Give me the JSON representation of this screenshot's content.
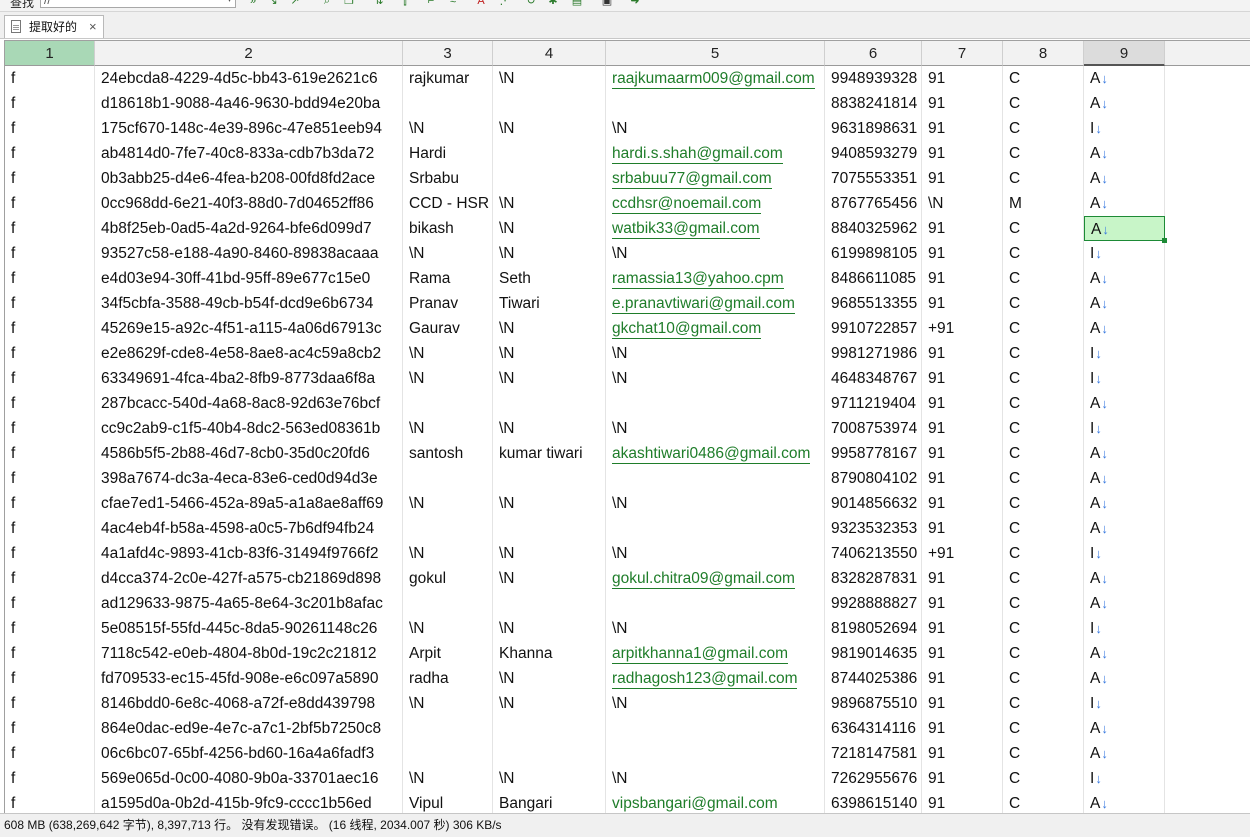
{
  "toolbar": {
    "find_label": "查找",
    "find_value": "//",
    "icons": [
      "replace-icon",
      "find-next-icon",
      "find-prev-icon",
      "search-panel-icon",
      "copy-icon",
      "sort-icon",
      "column-icon",
      "wrap-icon",
      "font-icon",
      "filter-icon",
      "refresh-icon",
      "bug-icon",
      "grid-icon",
      "view-icon",
      "run-icon"
    ]
  },
  "tab": {
    "title": "提取好的",
    "close": "×"
  },
  "columns": [
    "1",
    "2",
    "3",
    "4",
    "5",
    "6",
    "7",
    "8",
    "9"
  ],
  "rows": [
    [
      "f",
      "24ebcda8-4229-4d5c-bb43-619e2621c6",
      "rajkumar",
      "\\N",
      "raajkumaarm009@gmail.com",
      "9948939328",
      "91",
      "C",
      "A"
    ],
    [
      "f",
      "d18618b1-9088-4a46-9630-bdd94e20ba",
      "",
      "",
      "",
      "8838241814",
      "91",
      "C",
      "A"
    ],
    [
      "f",
      "175cf670-148c-4e39-896c-47e851eeb94",
      "\\N",
      "\\N",
      "\\N",
      "9631898631",
      "91",
      "C",
      "I"
    ],
    [
      "f",
      "ab4814d0-7fe7-40c8-833a-cdb7b3da72",
      "Hardi",
      "",
      "hardi.s.shah@gmail.com",
      "9408593279",
      "91",
      "C",
      "A"
    ],
    [
      "f",
      "0b3abb25-d4e6-4fea-b208-00fd8fd2ace",
      "Srbabu",
      "",
      "srbabuu77@gmail.com",
      "7075553351",
      "91",
      "C",
      "A"
    ],
    [
      "f",
      "0cc968dd-6e21-40f3-88d0-7d04652ff86",
      "CCD - HSR",
      "\\N",
      "ccdhsr@noemail.com",
      "8767765456",
      "\\N",
      "M",
      "A"
    ],
    [
      "f",
      "4b8f25eb-0ad5-4a2d-9264-bfe6d099d7",
      "bikash",
      "\\N",
      "watbik33@gmail.com",
      "8840325962",
      "91",
      "C",
      "A"
    ],
    [
      "f",
      "93527c58-e188-4a90-8460-89838acaaa",
      "\\N",
      "\\N",
      "\\N",
      "6199898105",
      "91",
      "C",
      "I"
    ],
    [
      "f",
      "e4d03e94-30ff-41bd-95ff-89e677c15e0",
      "Rama",
      "Seth",
      "ramassia13@yahoo.cpm",
      "8486611085",
      "91",
      "C",
      "A"
    ],
    [
      "f",
      "34f5cbfa-3588-49cb-b54f-dcd9e6b6734",
      "Pranav",
      "Tiwari",
      "e.pranavtiwari@gmail.com",
      "9685513355",
      "91",
      "C",
      "A"
    ],
    [
      "f",
      "45269e15-a92c-4f51-a115-4a06d67913c",
      "Gaurav",
      "\\N",
      "gkchat10@gmail.com",
      "9910722857",
      "+91",
      "C",
      "A"
    ],
    [
      "f",
      "e2e8629f-cde8-4e58-8ae8-ac4c59a8cb2",
      "\\N",
      "\\N",
      "\\N",
      "9981271986",
      "91",
      "C",
      "I"
    ],
    [
      "f",
      "63349691-4fca-4ba2-8fb9-8773daa6f8a",
      "\\N",
      "\\N",
      "\\N",
      "4648348767",
      "91",
      "C",
      "I"
    ],
    [
      "f",
      "287bcacc-540d-4a68-8ac8-92d63e76bcf",
      "",
      "",
      "",
      "9711219404",
      "91",
      "C",
      "A"
    ],
    [
      "f",
      "cc9c2ab9-c1f5-40b4-8dc2-563ed08361b",
      "\\N",
      "\\N",
      "\\N",
      "7008753974",
      "91",
      "C",
      "I"
    ],
    [
      "f",
      "4586b5f5-2b88-46d7-8cb0-35d0c20fd6",
      "santosh",
      "kumar tiwari",
      "akashtiwari0486@gmail.com",
      "9958778167",
      "91",
      "C",
      "A"
    ],
    [
      "f",
      "398a7674-dc3a-4eca-83e6-ced0d94d3e",
      "",
      "",
      "",
      "8790804102",
      "91",
      "C",
      "A"
    ],
    [
      "f",
      "cfae7ed1-5466-452a-89a5-a1a8ae8aff69",
      "\\N",
      "\\N",
      "\\N",
      "9014856632",
      "91",
      "C",
      "A"
    ],
    [
      "f",
      "4ac4eb4f-b58a-4598-a0c5-7b6df94fb24",
      "",
      "",
      "",
      "9323532353",
      "91",
      "C",
      "A"
    ],
    [
      "f",
      "4a1afd4c-9893-41cb-83f6-31494f9766f2",
      "\\N",
      "\\N",
      "\\N",
      "7406213550",
      "+91",
      "C",
      "I"
    ],
    [
      "f",
      "d4cca374-2c0e-427f-a575-cb21869d898",
      "gokul",
      "\\N",
      "gokul.chitra09@gmail.com",
      "8328287831",
      "91",
      "C",
      "A"
    ],
    [
      "f",
      "ad129633-9875-4a65-8e64-3c201b8afac",
      "",
      "",
      "",
      "9928888827",
      "91",
      "C",
      "A"
    ],
    [
      "f",
      "5e08515f-55fd-445c-8da5-90261148c26",
      "\\N",
      "\\N",
      "\\N",
      "8198052694",
      "91",
      "C",
      "I"
    ],
    [
      "f",
      "7118c542-e0eb-4804-8b0d-19c2c21812",
      "Arpit",
      "Khanna",
      "arpitkhanna1@gmail.com",
      "9819014635",
      "91",
      "C",
      "A"
    ],
    [
      "f",
      "fd709533-ec15-45fd-908e-e6c097a5890",
      "radha",
      "\\N",
      "radhagosh123@gmail.com",
      "8744025386",
      "91",
      "C",
      "A"
    ],
    [
      "f",
      "8146bdd0-6e8c-4068-a72f-e8dd439798",
      "\\N",
      "\\N",
      "\\N",
      "9896875510",
      "91",
      "C",
      "I"
    ],
    [
      "f",
      "864e0dac-ed9e-4e7c-a7c1-2bf5b7250c8",
      "",
      "",
      "",
      "6364314116",
      "91",
      "C",
      "A"
    ],
    [
      "f",
      "06c6bc07-65bf-4256-bd60-16a4a6fadf3",
      "",
      "",
      "",
      "7218147581",
      "91",
      "C",
      "A"
    ],
    [
      "f",
      "569e065d-0c00-4080-9b0a-33701aec16",
      "\\N",
      "\\N",
      "\\N",
      "7262955676",
      "91",
      "C",
      "I"
    ],
    [
      "f",
      "a1595d0a-0b2d-415b-9fc9-cccc1b56ed",
      "Vipul",
      "Bangari",
      "vipsbangari@gmail.com",
      "6398615140",
      "91",
      "C",
      "A"
    ]
  ],
  "selected": {
    "row": 6,
    "col": 8
  },
  "status": "608 MB (638,269,642 字节), 8,397,713 行。 没有发现错误。 (16 线程, 2034.007 秒) 306 KB/s",
  "colors": {
    "email": "#1f7d2a",
    "arrow": "#3a7be0",
    "selection": "#1d8a36",
    "active_header": "#a9d8b6"
  }
}
